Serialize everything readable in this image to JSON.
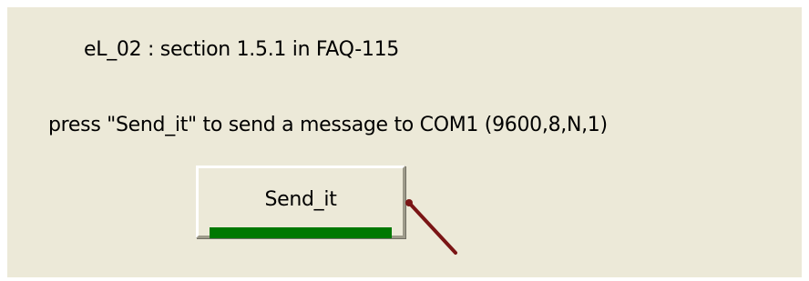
{
  "window": {
    "title_line": "eL_02 : section 1.5.1 in FAQ-115",
    "instruction_line": "press \"Send_it\" to send a message to COM1 (9600,8,N,1)"
  },
  "button": {
    "label": "Send_it",
    "progress_percent": 100,
    "progress_color": "#007800"
  },
  "annotation": {
    "icon": "pointer-arrow-icon",
    "color": "#7a1515"
  },
  "colors": {
    "panel_background": "#ece9d8"
  }
}
